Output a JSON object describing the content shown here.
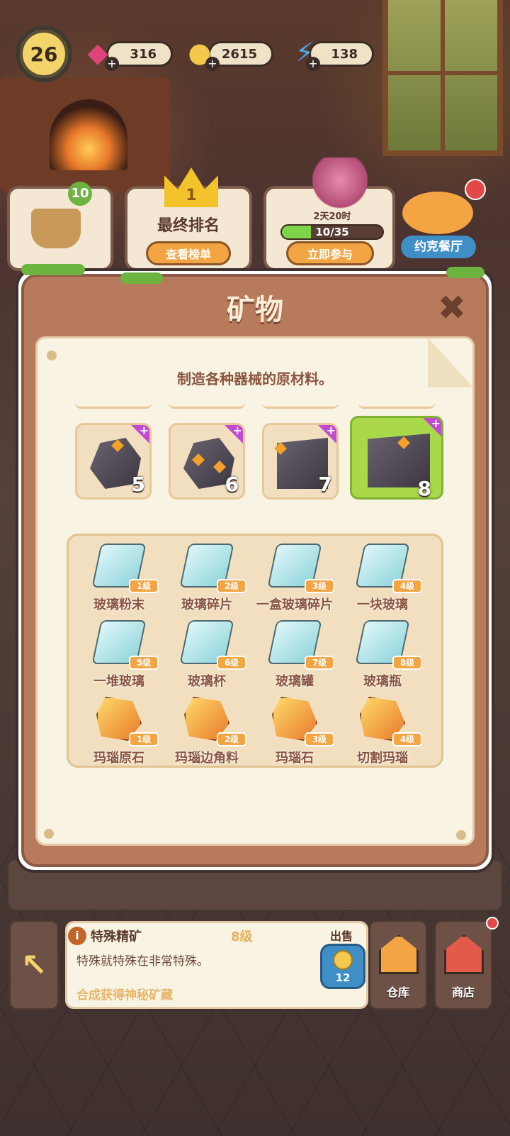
{
  "hud": {
    "player_level": "26",
    "gems": "316",
    "coins": "2615",
    "energy": "138",
    "gem_icon": "gem-icon",
    "coin_icon": "coin-icon",
    "energy_icon": "lightning-icon"
  },
  "events": {
    "order_badge": "10",
    "ranking_title": "最终排名",
    "ranking_rank": "1",
    "ranking_button": "查看榜单",
    "event_time": "2天20时",
    "event_progress_text": "10/35",
    "event_progress": 0.286,
    "event_button": "立即参与",
    "restaurant_name": "约克餐厅"
  },
  "modal": {
    "title": "矿物",
    "description": "制造各种器械的原材料。",
    "tiers": [
      {
        "num": "5"
      },
      {
        "num": "6"
      },
      {
        "num": "7"
      },
      {
        "num": "8"
      }
    ],
    "items": [
      {
        "name": "玻璃粉末",
        "level": "1级",
        "kind": "glass"
      },
      {
        "name": "玻璃碎片",
        "level": "2级",
        "kind": "glass"
      },
      {
        "name": "一盒玻璃碎片",
        "level": "3级",
        "kind": "glass"
      },
      {
        "name": "一块玻璃",
        "level": "4级",
        "kind": "glass"
      },
      {
        "name": "一堆玻璃",
        "level": "5级",
        "kind": "glass"
      },
      {
        "name": "玻璃杯",
        "level": "6级",
        "kind": "glass"
      },
      {
        "name": "玻璃罐",
        "level": "7级",
        "kind": "glass"
      },
      {
        "name": "玻璃瓶",
        "level": "8级",
        "kind": "glass"
      },
      {
        "name": "玛瑙原石",
        "level": "1级",
        "kind": "agate"
      },
      {
        "name": "玛瑙边角料",
        "level": "2级",
        "kind": "agate"
      },
      {
        "name": "玛瑙石",
        "level": "3级",
        "kind": "agate"
      },
      {
        "name": "切割玛瑙",
        "level": "4级",
        "kind": "agate"
      }
    ]
  },
  "info": {
    "name": "特殊精矿",
    "level": "8级",
    "description": "特殊就特殊在非常特殊。",
    "hint": "合成获得神秘矿藏",
    "sell_label": "出售",
    "sell_price": "12"
  },
  "nav": {
    "warehouse": "仓库",
    "shop": "商店"
  },
  "colors": {
    "accent_orange": "#f3a443",
    "modal_brown": "#b77a5c",
    "selected_green": "#a9d84a"
  }
}
